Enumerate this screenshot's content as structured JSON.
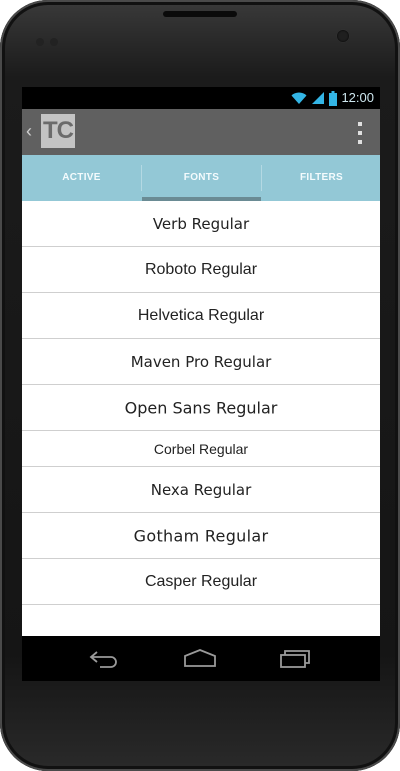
{
  "status_bar": {
    "time": "12:00",
    "wifi_icon": "wifi-icon",
    "signal_icon": "signal-icon",
    "battery_icon": "battery-icon"
  },
  "action_bar": {
    "app_icon_text": "TC",
    "back_icon": "chevron-left-icon",
    "overflow_icon": "overflow-menu-icon"
  },
  "tabs": [
    {
      "label": "ACTIVE",
      "selected": false
    },
    {
      "label": "FONTS",
      "selected": true
    },
    {
      "label": "FILTERS",
      "selected": false
    }
  ],
  "fonts": [
    "Verb Regular",
    "Roboto Regular",
    "Helvetica Regular",
    "Maven Pro Regular",
    "Open Sans Regular",
    "Corbel Regular",
    "Nexa Regular",
    "Gotham Regular",
    "Casper Regular"
  ],
  "nav_bar": {
    "back_icon": "back-icon",
    "home_icon": "home-icon",
    "recents_icon": "recents-icon"
  },
  "colors": {
    "tab_bar": "#93c8d6",
    "tab_indicator": "#6a8b94",
    "action_bar": "#606060"
  }
}
